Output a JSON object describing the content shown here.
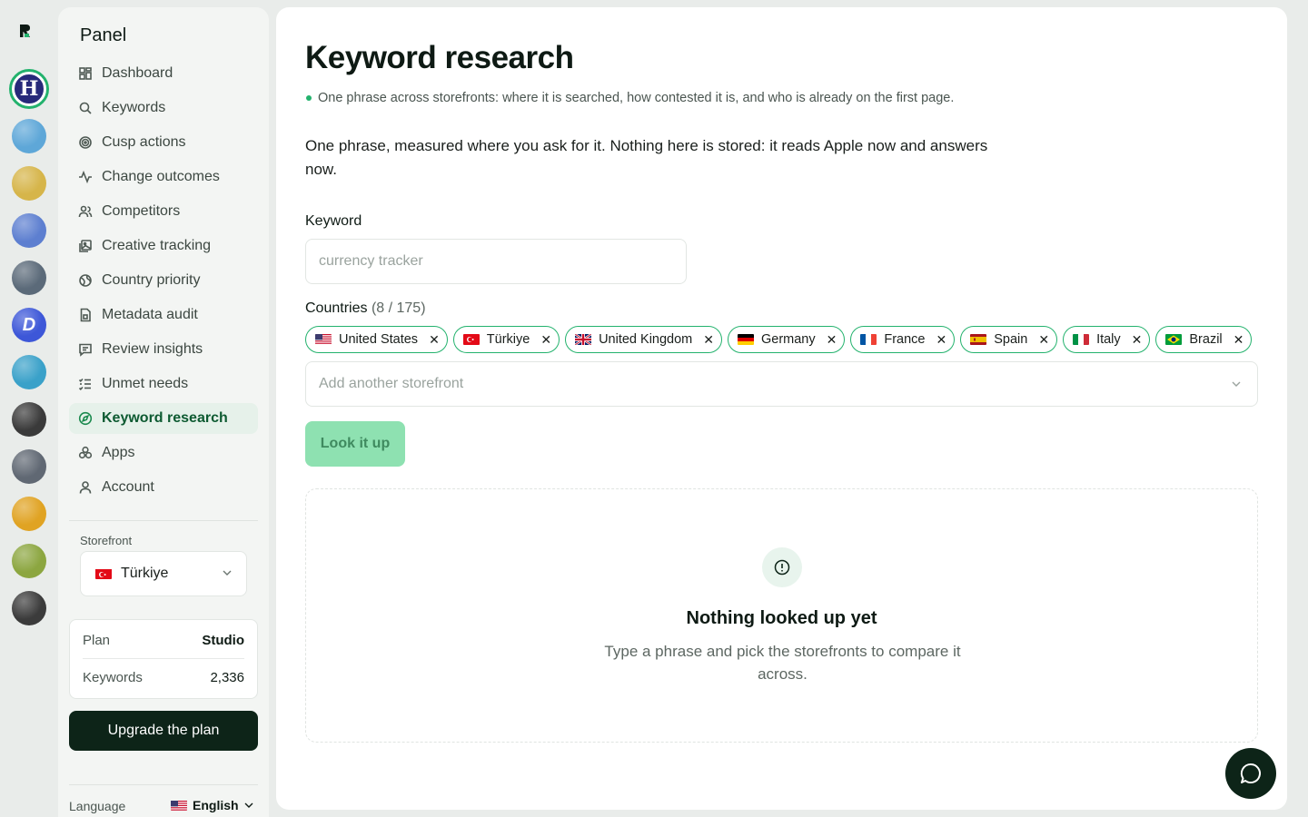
{
  "rail": {
    "apps": [
      {
        "name": "app-h",
        "letter": "H",
        "active": true,
        "color": "#272a7a"
      },
      {
        "name": "app-2",
        "color": "#5ea7d8"
      },
      {
        "name": "app-3",
        "color": "#d6b54a"
      },
      {
        "name": "app-4",
        "color": "#5d7fd0"
      },
      {
        "name": "app-5",
        "color": "#5b6a79"
      },
      {
        "name": "app-6",
        "letter": "D",
        "color": "#3d57d8"
      },
      {
        "name": "app-7",
        "color": "#3aa1c9"
      },
      {
        "name": "app-8",
        "color": "#3a3a3a"
      },
      {
        "name": "app-9",
        "color": "#606873"
      },
      {
        "name": "app-10",
        "color": "#e0a323"
      },
      {
        "name": "app-11",
        "color": "#8ca640"
      },
      {
        "name": "app-12",
        "color": "#3b3b3b"
      }
    ]
  },
  "sidebar": {
    "title": "Panel",
    "items": [
      {
        "label": "Dashboard",
        "icon": "grid-icon"
      },
      {
        "label": "Keywords",
        "icon": "search-icon"
      },
      {
        "label": "Cusp actions",
        "icon": "target-icon"
      },
      {
        "label": "Change outcomes",
        "icon": "activity-icon"
      },
      {
        "label": "Competitors",
        "icon": "users-icon"
      },
      {
        "label": "Creative tracking",
        "icon": "images-icon"
      },
      {
        "label": "Country priority",
        "icon": "globe-icon"
      },
      {
        "label": "Metadata audit",
        "icon": "file-icon"
      },
      {
        "label": "Review insights",
        "icon": "message-icon"
      },
      {
        "label": "Unmet needs",
        "icon": "checklist-icon"
      },
      {
        "label": "Keyword research",
        "icon": "compass-icon",
        "active": true
      },
      {
        "label": "Apps",
        "icon": "apps-icon"
      },
      {
        "label": "Account",
        "icon": "user-icon"
      }
    ],
    "storefront_label": "Storefront",
    "storefront_value": "Türkiye",
    "plan_label": "Plan",
    "plan_value": "Studio",
    "keywords_label": "Keywords",
    "keywords_value": "2,336",
    "upgrade_label": "Upgrade the plan",
    "language_label": "Language",
    "language_value": "English"
  },
  "main": {
    "title": "Keyword research",
    "bullet": "One phrase across storefronts: where it is searched, how contested it is, and who is already on the first page.",
    "description": "One phrase, measured where you ask for it. Nothing here is stored: it reads Apple now and answers now.",
    "keyword_label": "Keyword",
    "keyword_placeholder": "currency tracker",
    "countries_label": "Countries",
    "countries_count": "(8 / 175)",
    "countries": [
      {
        "name": "United States",
        "flag": "us"
      },
      {
        "name": "Türkiye",
        "flag": "tr"
      },
      {
        "name": "United Kingdom",
        "flag": "gb"
      },
      {
        "name": "Germany",
        "flag": "de"
      },
      {
        "name": "France",
        "flag": "fr"
      },
      {
        "name": "Spain",
        "flag": "es"
      },
      {
        "name": "Italy",
        "flag": "it"
      },
      {
        "name": "Brazil",
        "flag": "br"
      }
    ],
    "add_placeholder": "Add another storefront",
    "lookup_label": "Look it up",
    "empty_title": "Nothing looked up yet",
    "empty_subtitle": "Type a phrase and pick the storefronts to compare it across."
  },
  "colors": {
    "accent": "#23b26d",
    "dark": "#0d2418",
    "button_disabled": "#8ee1b1"
  }
}
